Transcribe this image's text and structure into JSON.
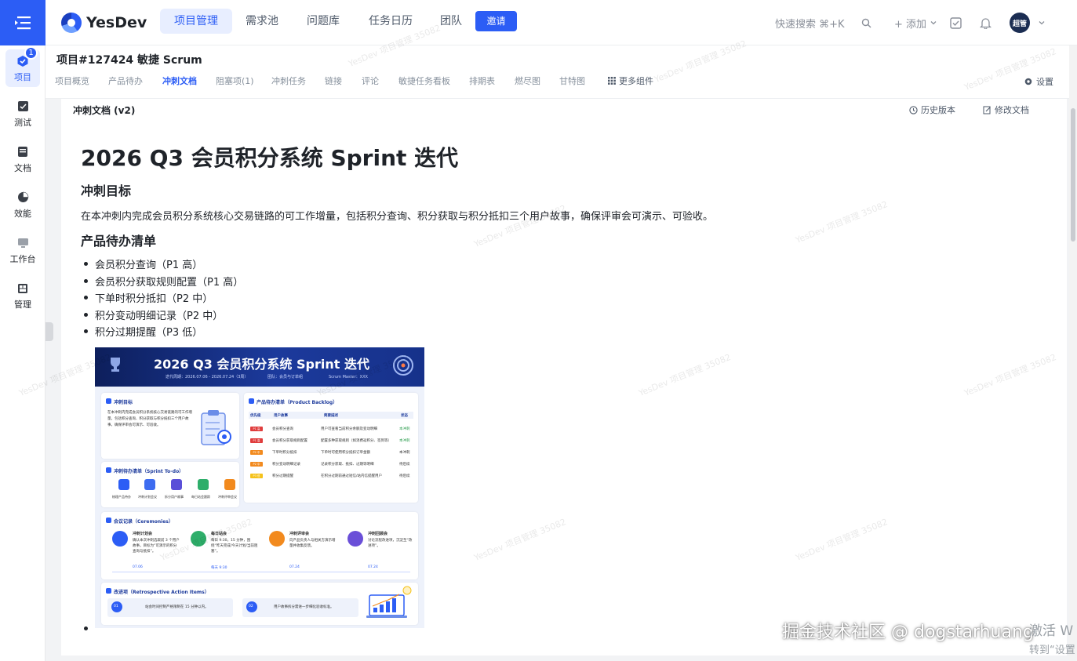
{
  "sidebar": {
    "items": [
      {
        "label": "项目",
        "icon": "project-icon",
        "badge": "1"
      },
      {
        "label": "测试",
        "icon": "test-icon"
      },
      {
        "label": "文档",
        "icon": "doc-icon"
      },
      {
        "label": "效能",
        "icon": "pie-chart-icon"
      },
      {
        "label": "工作台",
        "icon": "workbench-icon"
      },
      {
        "label": "管理",
        "icon": "grid-icon"
      }
    ]
  },
  "topnav": {
    "brand": "YesDev",
    "tabs": [
      "项目管理",
      "需求池",
      "问题库",
      "任务日历",
      "团队"
    ],
    "invite": "邀请",
    "search": "快速搜索 ⌘+K",
    "add": "+ 添加",
    "avatar": "超管"
  },
  "project": {
    "title": "项目#127424 敏捷 Scrum",
    "tabs": [
      "项目概览",
      "产品待办",
      "冲刺文档",
      "阻塞项(1)",
      "冲刺任务",
      "链接",
      "评论",
      "敏捷任务看板",
      "排期表",
      "燃尽图",
      "甘特图",
      "更多组件"
    ],
    "settings": "设置"
  },
  "doc": {
    "label": "冲刺文档 (v2)",
    "history": "历史版本",
    "edit": "修改文档",
    "h1": "2026 Q3 会员积分系统 Sprint 迭代",
    "goal_heading": "冲刺目标",
    "goal_text": "在本冲刺内完成会员积分系统核心交易链路的可工作增量，包括积分查询、积分获取与积分抵扣三个用户故事，确保评审会可演示、可验收。",
    "backlog_heading": "产品待办清单",
    "backlog": [
      "会员积分查询（P1 高）",
      "会员积分获取规则配置（P1 高）",
      "下单时积分抵扣（P2 中）",
      "积分变动明细记录（P2 中）",
      "积分过期提醒（P3 低）"
    ]
  },
  "embed": {
    "title": "2026 Q3 会员积分系统 Sprint 迭代",
    "meta": [
      "迭代周期：2026.07.06 - 2026.07.24（3周）",
      "团队：会员与订单组",
      "Scrum Master：XXX"
    ],
    "goal_title": "冲刺目标",
    "goal_text": "在本冲刺内完成会员积分系统核心交易链路的可工作增量，包括积分查询、积分获取与积分抵扣三个用户故事，确保评审会可演示、可验收。",
    "backlog_title": "产品待办清单（Product Backlog）",
    "backlog_cols": [
      "优先级",
      "用户故事",
      "简要描述",
      "状态"
    ],
    "backlog_rows": [
      [
        "P1 高",
        "会员积分查询",
        "用户可查看当前积分余额及变动明细",
        "本冲刺"
      ],
      [
        "P1 高",
        "会员积分获取规则配置",
        "配置多种获取规则（如消费返积分、签到等）",
        "本冲刺"
      ],
      [
        "P2 中",
        "下单时积分抵扣",
        "下单时可使用积分抵扣订单金额",
        "本冲刺"
      ],
      [
        "P2 中",
        "积分变动明细记录",
        "记录积分获取、抵扣、过期等明细",
        "待后续"
      ],
      [
        "P3 低",
        "积分过期提醒",
        "在积分过期前通过短信/站内信提醒用户",
        "待后续"
      ]
    ],
    "todo_title": "冲刺待办清单（Sprint To-do）",
    "todo": [
      "梳理产品待办",
      "冲刺计划会议",
      "拆分用户故事",
      "每日站会跟踪",
      "冲刺评审会议"
    ],
    "cer_title": "会议记录（Ceremonies）",
    "ceremonies": [
      {
        "name": "冲刺计划会",
        "desc": "确认本次冲刺选取前 3 个用户故事，目标为“可演示的积分查询与抵扣”。",
        "date": "07.06"
      },
      {
        "name": "每日站会",
        "desc": "每日 9:30，15 分钟，围绕“昨天完成/今天计划/当前阻塞”。",
        "date": "每天 9:30"
      },
      {
        "name": "冲刺评审会",
        "desc": "向产品负责人与相关方演示增量并收集反馈。",
        "date": "07.24"
      },
      {
        "name": "冲刺回顾会",
        "desc": "讨论流程改进项，沉淀至“改进项”。",
        "date": "07.24"
      }
    ],
    "retro_title": "改进项（Retrospective Action Items）",
    "retro": [
      {
        "n": "01",
        "text": "站会时间控制严格限制在 15 分钟以内。"
      },
      {
        "n": "02",
        "text": "用户故事拆分需进一步细化验收标准。"
      }
    ]
  },
  "watermark": "YesDev 项目管理 35082",
  "overlay": {
    "juejin": "掘金技术社区 @ dogstarhuang",
    "activate": "激活 W",
    "activate2": "转到“设置"
  },
  "colors": {
    "accent": "#2c5df5",
    "p1": "#e03d3d",
    "p2": "#f28a1e",
    "p3": "#f5c21b"
  }
}
